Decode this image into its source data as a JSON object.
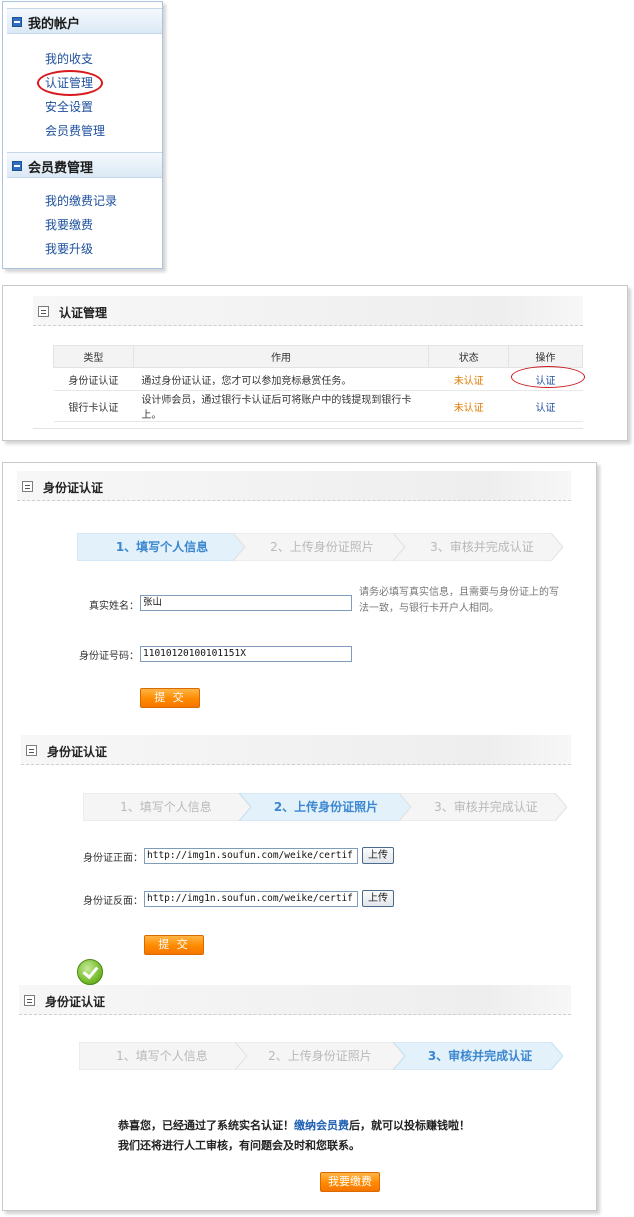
{
  "sidebar": {
    "sections": [
      {
        "title": "我的帐户",
        "items": [
          "我的收支",
          "认证管理",
          "安全设置",
          "会员费管理"
        ]
      },
      {
        "title": "会员费管理",
        "items": [
          "我的缴费记录",
          "我要缴费",
          "我要升级"
        ]
      }
    ]
  },
  "cert_mgmt": {
    "title": "认证管理",
    "columns": [
      "类型",
      "作用",
      "状态",
      "操作"
    ],
    "rows": [
      {
        "type": "身份证认证",
        "desc": "通过身份证认证，您才可以参加竞标悬赏任务。",
        "status": "未认证",
        "action": "认证"
      },
      {
        "type": "银行卡认证",
        "desc": "设计师会员，通过银行卡认证后可将账户中的钱提现到银行卡上。",
        "status": "未认证",
        "action": "认证"
      }
    ]
  },
  "steps": [
    "1、填写个人信息",
    "2、上传身份证照片",
    "3、审核并完成认证"
  ],
  "step1": {
    "title": "身份证认证",
    "name_label": "真实姓名：",
    "name_value": "张山",
    "hint": "请务必填写真实信息，且需要与身份证上的写法一致，与银行卡开户人相同。",
    "id_label": "身份证号码：",
    "id_value": "11010120100101151X",
    "submit": "提 交"
  },
  "step2": {
    "title": "身份证认证",
    "front_label": "身份证正面：",
    "front_value": "http://img1n.soufun.com/weike/certif",
    "back_label": "身份证反面：",
    "back_value": "http://img1n.soufun.com/weike/certif",
    "upload": "上传",
    "submit": "提 交"
  },
  "step3": {
    "title": "身份证认证",
    "msg1_a": "恭喜您，已经通过了系统实名认证！",
    "msg1_link": "缴纳会员费",
    "msg1_b": "后，就可以投标赚钱啦！",
    "msg2": "我们还将进行人工审核，有问题会及时和您联系。",
    "pay_button": "我要缴费"
  },
  "colors": {
    "link": "#1d4f9c",
    "status": "#e07b00",
    "step_active": "#3d87d0",
    "button": "#ff8a00",
    "highlight": "#d8181d"
  }
}
